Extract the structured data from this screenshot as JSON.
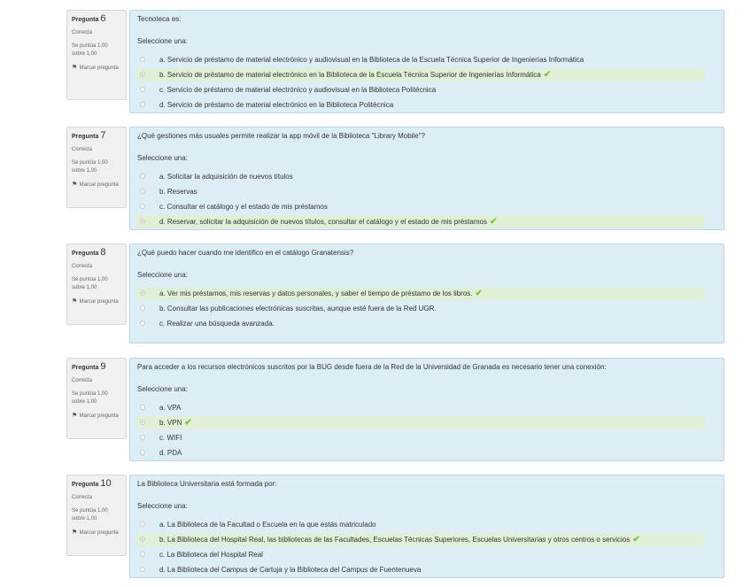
{
  "colors": {
    "question_bg": "#dcedf6",
    "correct_bg": "#e0f0d7",
    "check": "#7cc242",
    "info_bg": "#f0f0f0"
  },
  "labels": {
    "question_word": "Pregunta",
    "select_one": "Seleccione una:",
    "flag": "Marcar pregunta",
    "flag_icon": "flag-icon",
    "check_icon": "check-icon",
    "check_glyph": "✔"
  },
  "questions": [
    {
      "number": "6",
      "state": "Correcta",
      "grade": "Se puntúa 1,00 sobre 1,00",
      "text": "Tecnoteca es:",
      "options": [
        {
          "label": "a. Servicio de préstamo de material electrónico y audiovisual en la Biblioteca de la Escuela Técnica Superior de Ingenierías Informática",
          "selected": false
        },
        {
          "label": "b. Servicio de préstamo de material electrónico en la Biblioteca de la Escuela Técnica Superior de Ingenierías Informática",
          "selected": true
        },
        {
          "label": "c. Servicio de préstamo de material electrónico y audiovisual en la Biblioteca Politécnica",
          "selected": false
        },
        {
          "label": "d. Servicio de préstamo de material electrónico en la Biblioteca Politécnica",
          "selected": false
        }
      ]
    },
    {
      "number": "7",
      "state": "Correcta",
      "grade": "Se puntúa 1,00 sobre 1,00",
      "text": "¿Qué gestiones más usuales permite realizar la app móvil de la Biblioteca \"Library Mobile\"?",
      "options": [
        {
          "label": "a. Solicitar la adquisición de nuevos títulos",
          "selected": false
        },
        {
          "label": "b. Reservas",
          "selected": false
        },
        {
          "label": "c. Consultar el catálogo y el estado de mis préstamos",
          "selected": false
        },
        {
          "label": "d. Reservar, solicitar la adquisición de nuevos títulos, consultar el catálogo y el estado de mis préstamos",
          "selected": true
        }
      ]
    },
    {
      "number": "8",
      "state": "Correcta",
      "grade": "Se puntúa 1,00 sobre 1,00",
      "text": "¿Qué puedo hacer cuando me identifico en el catálogo Granatensis?",
      "options": [
        {
          "label": "a. Ver mis préstamos, mis reservas y datos personales, y saber el tiempo de préstamo de los libros.",
          "selected": true
        },
        {
          "label": "b. Consultar las publicaciones electrónicas suscritas, aunque esté fuera de la Red UGR.",
          "selected": false
        },
        {
          "label": "c. Realizar una búsqueda avanzada.",
          "selected": false
        }
      ]
    },
    {
      "number": "9",
      "state": "Correcta",
      "grade": "Se puntúa 1,00 sobre 1,00",
      "text": "Para acceder a los recursos electrónicos suscritos por la BUG desde fuera de la Red de la Universidad de Granada es necesario tener una conexión:",
      "options": [
        {
          "label": "a. VPA",
          "selected": false
        },
        {
          "label": "b. VPN",
          "selected": true
        },
        {
          "label": "c. WIFI",
          "selected": false
        },
        {
          "label": "d. PDA",
          "selected": false
        }
      ]
    },
    {
      "number": "10",
      "state": "Correcta",
      "grade": "Se puntúa 1,00 sobre 1,00",
      "text": "La Biblioteca Universitaria está formada por:",
      "options": [
        {
          "label": "a. La Biblioteca de la Facultad o Escuela en la que estás matriculado",
          "selected": false
        },
        {
          "label": "b. La Biblioteca del Hospital Real, las bibliotecas de las Facultades, Escuelas Técnicas Superiores, Escuelas Universitarias y otros centros o servicios",
          "selected": true
        },
        {
          "label": "c. La Biblioteca del Hospital Real",
          "selected": false
        },
        {
          "label": "d. La Biblioteca del Campus de Cartuja y la Biblioteca del Campus de Fuentenueva",
          "selected": false
        }
      ]
    }
  ]
}
